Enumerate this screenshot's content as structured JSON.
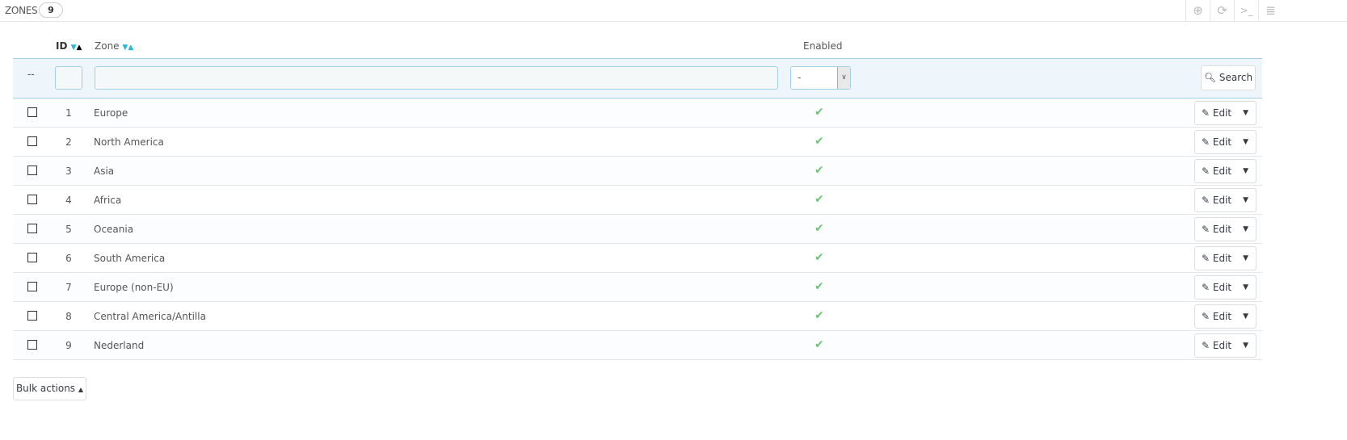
{
  "header": {
    "title": "ZONES",
    "count": "9"
  },
  "toolbar": {
    "icons": [
      "add-icon",
      "refresh-icon",
      "terminal-icon",
      "database-icon"
    ]
  },
  "columns": {
    "id": "ID",
    "zone": "Zone",
    "enabled": "Enabled"
  },
  "filter": {
    "bulk_placeholder": "--",
    "enabled_value": "-",
    "search_label": "Search"
  },
  "rows": [
    {
      "id": "1",
      "zone": "Europe",
      "enabled": true
    },
    {
      "id": "2",
      "zone": "North America",
      "enabled": true
    },
    {
      "id": "3",
      "zone": "Asia",
      "enabled": true
    },
    {
      "id": "4",
      "zone": "Africa",
      "enabled": true
    },
    {
      "id": "5",
      "zone": "Oceania",
      "enabled": true
    },
    {
      "id": "6",
      "zone": "South America",
      "enabled": true
    },
    {
      "id": "7",
      "zone": "Europe (non-EU)",
      "enabled": true
    },
    {
      "id": "8",
      "zone": "Central America/Antilla",
      "enabled": true
    },
    {
      "id": "9",
      "zone": "Nederland",
      "enabled": true
    }
  ],
  "row_action": "Edit",
  "bulk_actions": "Bulk actions",
  "colors": {
    "accent": "#25b9d7",
    "check": "#72c279",
    "filter_bg": "#eef5fb"
  }
}
